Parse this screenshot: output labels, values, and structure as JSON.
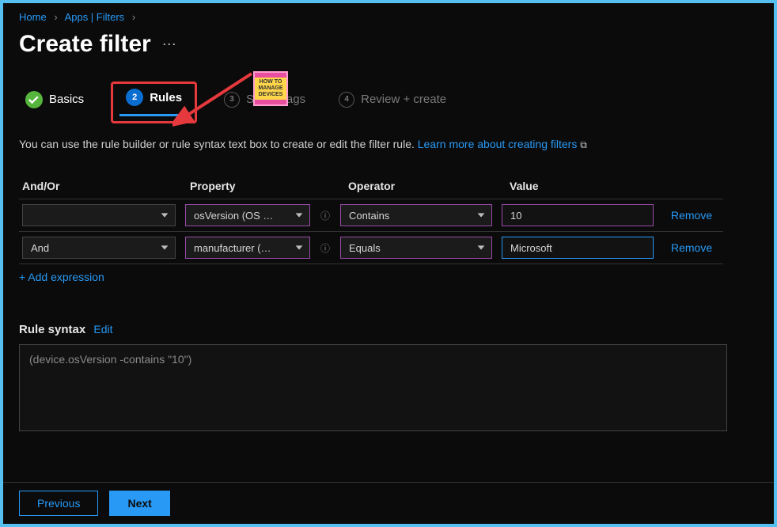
{
  "breadcrumb": {
    "home": "Home",
    "apps": "Apps | Filters"
  },
  "title": "Create filter",
  "steps": {
    "s1": "Basics",
    "s2_num": "2",
    "s2": "Rules",
    "s3_num": "3",
    "s3": "Scope tags",
    "s4_num": "4",
    "s4": "Review + create"
  },
  "desc": {
    "text": "You can use the rule builder or rule syntax text box to create or edit the filter rule. ",
    "link": "Learn more about creating filters"
  },
  "headers": {
    "andor": "And/Or",
    "property": "Property",
    "operator": "Operator",
    "value": "Value"
  },
  "rows": [
    {
      "andor": "",
      "property": "osVersion (OS …",
      "operator": "Contains",
      "value": "10",
      "remove": "Remove"
    },
    {
      "andor": "And",
      "property": "manufacturer (…",
      "operator": "Equals",
      "value": "Microsoft",
      "remove": "Remove"
    }
  ],
  "add_expression": "+ Add expression",
  "syntax": {
    "label": "Rule syntax",
    "edit": "Edit",
    "content": "(device.osVersion -contains \"10\")"
  },
  "footer": {
    "previous": "Previous",
    "next": "Next"
  },
  "sticker": "HOW TO MANAGE DEVICES"
}
